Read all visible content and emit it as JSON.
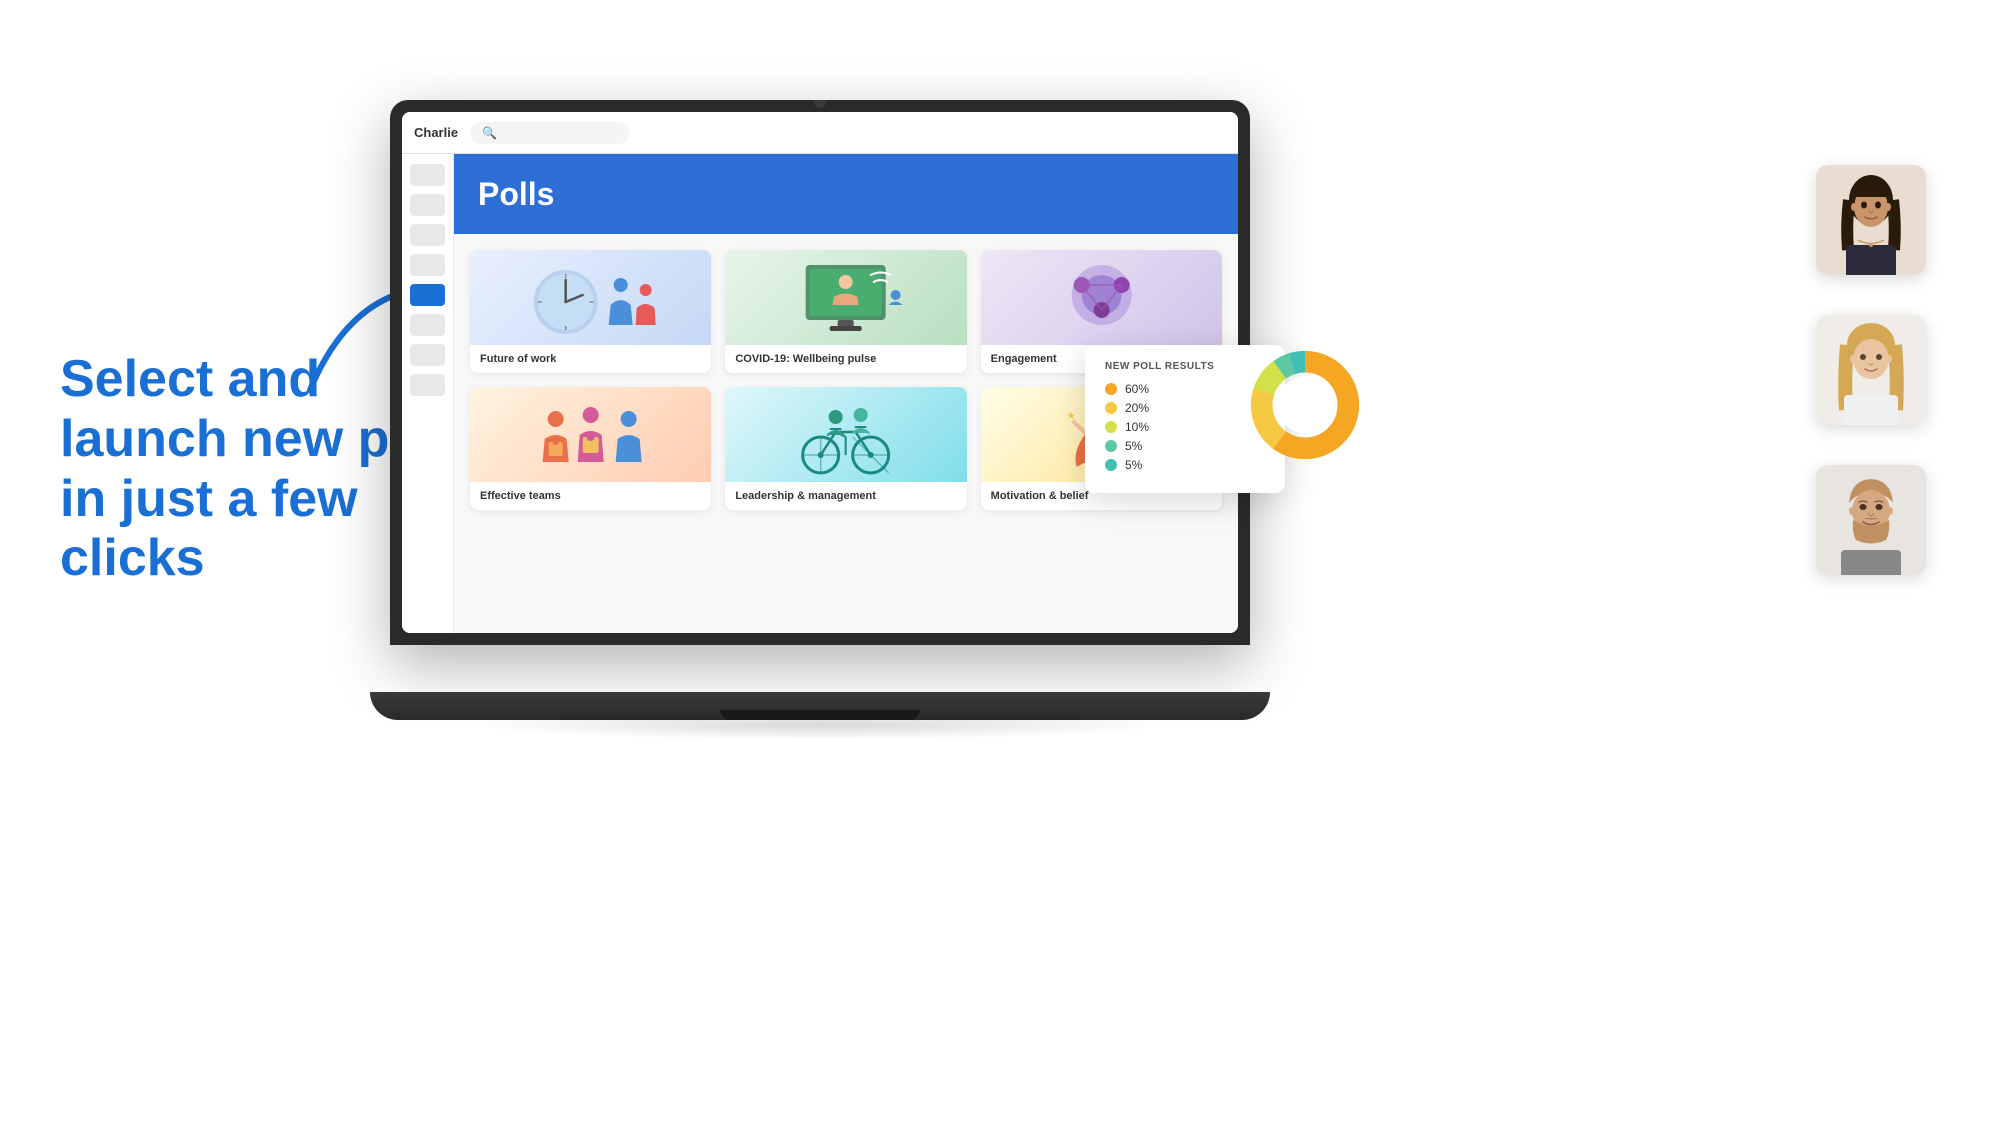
{
  "app": {
    "name": "Charlie",
    "search_placeholder": ""
  },
  "left_text": {
    "headline": "Select and launch new polls in just a few clicks"
  },
  "polls_page": {
    "title": "Polls",
    "cards": [
      {
        "id": "future-of-work",
        "label": "Future of work",
        "color_class": "card-future"
      },
      {
        "id": "covid",
        "label": "COVID-19: Wellbeing pulse",
        "color_class": "card-covid"
      },
      {
        "id": "engagement",
        "label": "Engagement",
        "color_class": "card-engagement"
      },
      {
        "id": "effective-teams",
        "label": "Effective teams",
        "color_class": "card-teams"
      },
      {
        "id": "leadership",
        "label": "Leadership & management",
        "color_class": "card-leadership"
      },
      {
        "id": "motivation",
        "label": "Motivation & belief",
        "color_class": "card-motivation"
      }
    ]
  },
  "poll_results": {
    "title": "NEW POLL RESULTS",
    "segments": [
      {
        "label": "60%",
        "color": "#f5a623",
        "pct": 60
      },
      {
        "label": "20%",
        "color": "#f5c842",
        "pct": 20
      },
      {
        "label": "10%",
        "color": "#d4e04a",
        "pct": 10
      },
      {
        "label": "5%",
        "color": "#5bc8a0",
        "pct": 5
      },
      {
        "label": "5%",
        "color": "#40c0b0",
        "pct": 5
      }
    ]
  },
  "sidebar": {
    "items": [
      {
        "active": false
      },
      {
        "active": false
      },
      {
        "active": false
      },
      {
        "active": false
      },
      {
        "active": true
      },
      {
        "active": false
      },
      {
        "active": false
      },
      {
        "active": false
      }
    ]
  },
  "colors": {
    "accent_blue": "#1a6fd4",
    "polls_header": "#2d6fd4",
    "white": "#ffffff"
  }
}
